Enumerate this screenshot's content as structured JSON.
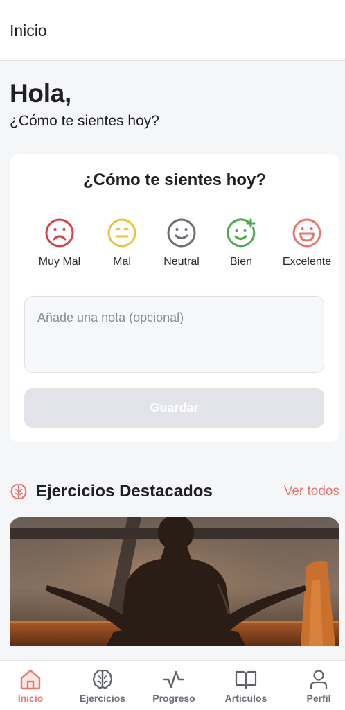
{
  "header": {
    "title": "Inicio"
  },
  "greeting": {
    "title": "Hola,",
    "subtitle": "¿Cómo te sientes hoy?"
  },
  "mood_card": {
    "title": "¿Cómo te sientes hoy?",
    "moods": [
      {
        "label": "Muy Mal",
        "icon": "frown-face-icon",
        "color": "#d0444a"
      },
      {
        "label": "Mal",
        "icon": "neutral-face-icon",
        "color": "#eac23b"
      },
      {
        "label": "Neutral",
        "icon": "smile-face-icon",
        "color": "#6b6e77"
      },
      {
        "label": "Bien",
        "icon": "smile-plus-face-icon",
        "color": "#4aa84f"
      },
      {
        "label": "Excelente",
        "icon": "laugh-face-icon",
        "color": "#e8756e"
      }
    ],
    "note_placeholder": "Añade una nota (opcional)",
    "save_label": "Guardar"
  },
  "exercises": {
    "title": "Ejercicios Destacados",
    "icon": "brain-icon",
    "see_all_label": "Ver todos"
  },
  "bottom_nav": {
    "items": [
      {
        "label": "Inicio",
        "icon": "home-icon",
        "active": true
      },
      {
        "label": "Ejercicios",
        "icon": "brain-icon",
        "active": false
      },
      {
        "label": "Progreso",
        "icon": "activity-icon",
        "active": false
      },
      {
        "label": "Artículos",
        "icon": "book-icon",
        "active": false
      },
      {
        "label": "Perfil",
        "icon": "user-icon",
        "active": false
      }
    ]
  },
  "colors": {
    "accent": "#e8756e",
    "background": "#f5f6f8",
    "card": "#ffffff",
    "button_disabled": "#e2e4e9"
  }
}
